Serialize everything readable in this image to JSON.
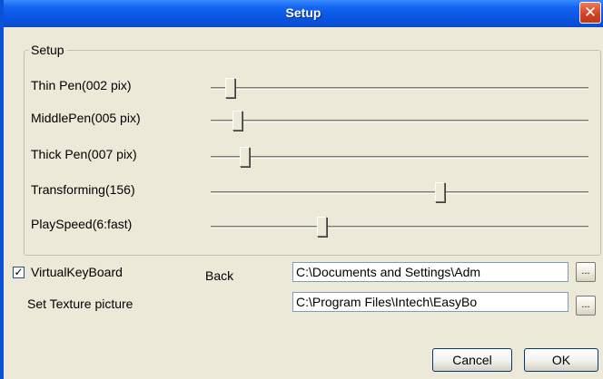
{
  "window": {
    "title": "Setup",
    "close_glyph": "✕",
    "title_bar_color": "#0a56e4",
    "close_button_color": "#d2401e"
  },
  "group": {
    "legend": "Setup"
  },
  "sliders": [
    {
      "label": "Thin Pen(002 pix)",
      "value_fraction": 0.04
    },
    {
      "label": "MiddlePen(005 pix)",
      "value_fraction": 0.06
    },
    {
      "label": "Thick Pen(007 pix)",
      "value_fraction": 0.08
    },
    {
      "label": "Transforming(156)",
      "value_fraction": 0.61
    },
    {
      "label": "PlaySpeed(6:fast)",
      "value_fraction": 0.29
    }
  ],
  "virtual_keyboard": {
    "label": "VirtualKeyBoard",
    "checked": true,
    "check_glyph": "✓"
  },
  "back": {
    "label": "Back",
    "path": "C:\\Documents and Settings\\Adm",
    "browse_label": "..."
  },
  "texture": {
    "label": "Set Texture picture",
    "path": "C:\\Program Files\\Intech\\EasyBo",
    "browse_label": "..."
  },
  "buttons": {
    "cancel": "Cancel",
    "ok": "OK"
  }
}
